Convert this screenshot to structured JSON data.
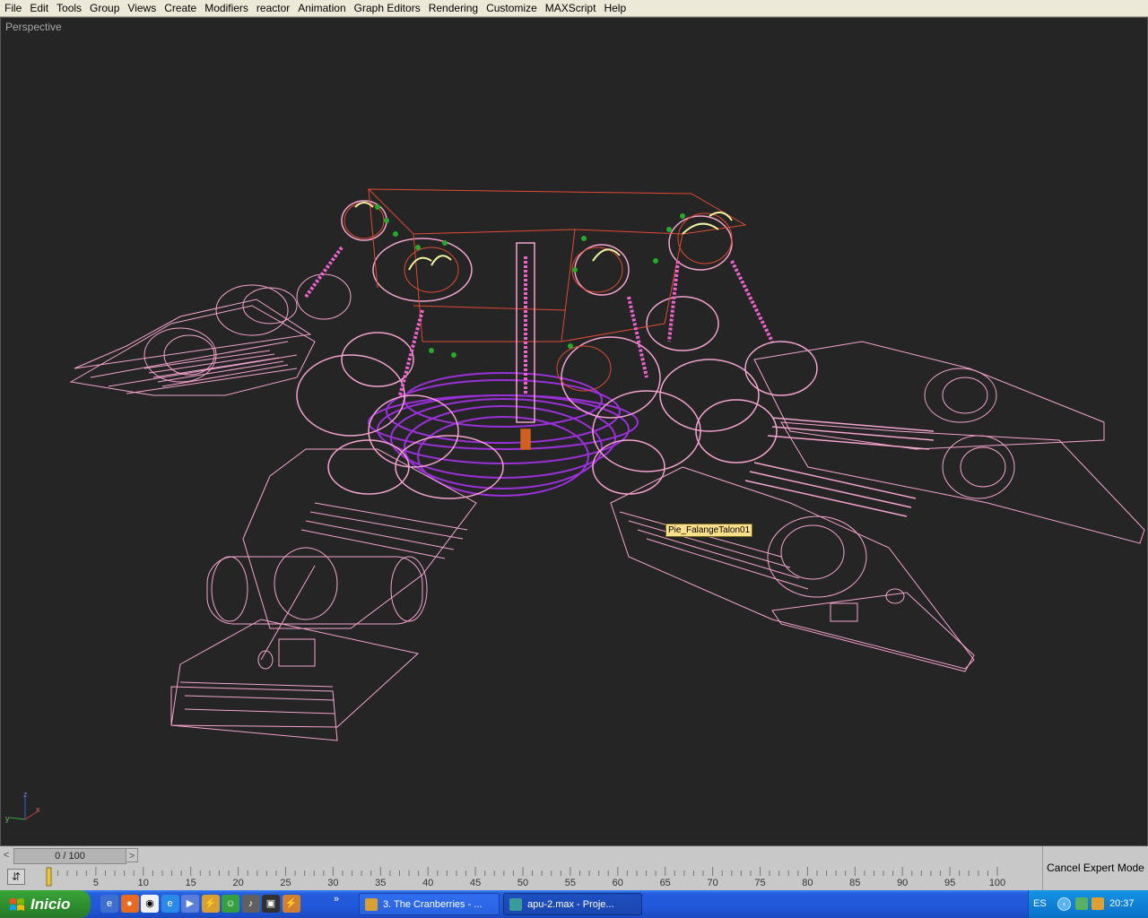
{
  "menubar": {
    "items": [
      "File",
      "Edit",
      "Tools",
      "Group",
      "Views",
      "Create",
      "Modifiers",
      "reactor",
      "Animation",
      "Graph Editors",
      "Rendering",
      "Customize",
      "MAXScript",
      "Help"
    ]
  },
  "viewport": {
    "label": "Perspective",
    "tooltip": "Pie_FalangeTalon01",
    "axis_labels": {
      "x": "x",
      "y": "y",
      "z": "z"
    },
    "colors": {
      "background": "#252525",
      "wire_pink": "#f5a3cf",
      "wire_red": "#e04a32",
      "wire_purple": "#9a30d8",
      "springs": "#f062d0",
      "helper_green": "#29a82e",
      "helper_yellow": "#f2f2a0",
      "pivot_orange": "#d06020"
    }
  },
  "timeline": {
    "frame_display": "0 / 100",
    "prev_arrow": "<",
    "next_arrow": ">",
    "tick_labels": [
      "5",
      "10",
      "15",
      "20",
      "25",
      "30",
      "35",
      "40",
      "45",
      "50",
      "55",
      "60",
      "65",
      "70",
      "75",
      "80",
      "85",
      "90",
      "95",
      "100"
    ],
    "current_frame": 0,
    "total_frames": 100
  },
  "expert_mode": {
    "cancel_label": "Cancel Expert Mode"
  },
  "taskbar": {
    "start_label": "Inicio",
    "quicklaunch_icons": [
      "explorer-icon",
      "firefox-icon",
      "panda-icon",
      "ie-icon",
      "media-player-icon",
      "3dsmax-icon",
      "messenger-icon",
      "winamp-icon",
      "media-icon",
      "max-shortcut-icon"
    ],
    "more": "»",
    "tasks": [
      {
        "label": "3. The Cranberries - ...",
        "icon": "3dsmax-icon"
      },
      {
        "label": "apu-2.max       - Proje...",
        "icon": "max-icon"
      }
    ],
    "language": "ES",
    "tray_arrow": "‹",
    "clock": "20:37"
  }
}
